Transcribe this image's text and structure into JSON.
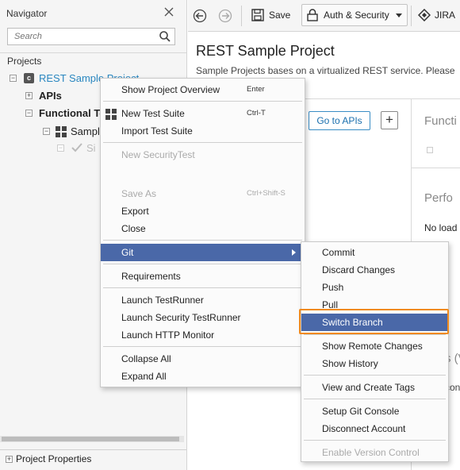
{
  "navigator": {
    "title": "Navigator",
    "search_placeholder": "Search",
    "projects_label": "Projects",
    "tree": {
      "project": "REST Sample Project",
      "apis": "APIs",
      "functional": "Functional Te",
      "suite": "Sampl",
      "case": "Si"
    },
    "project_properties": "Project Properties"
  },
  "toolbar": {
    "save": "Save",
    "auth": "Auth & Security",
    "jira": "JIRA"
  },
  "main": {
    "title": "REST Sample Project",
    "description": "Sample Projects bases on a virtualized REST service. Please",
    "goto_apis": "Go to APIs",
    "add": "+",
    "functional_title": "Functi",
    "performance_title": "Perfo",
    "no_load": "No load",
    "s_section": "s (V",
    "con_text": "con"
  },
  "context_menu": {
    "items": [
      {
        "label": "Show Project Overview",
        "shortcut": "Enter"
      },
      {
        "label": "New Test Suite",
        "shortcut": "Ctrl-T"
      },
      {
        "label": "Import Test Suite",
        "shortcut": ""
      },
      {
        "label": "New SecurityTest",
        "shortcut": ""
      },
      {
        "label": "Save As",
        "shortcut": "Ctrl+Shift-S"
      },
      {
        "label": "Export",
        "shortcut": ""
      },
      {
        "label": "Close",
        "shortcut": ""
      },
      {
        "label": "Git",
        "shortcut": ""
      },
      {
        "label": "Requirements",
        "shortcut": ""
      },
      {
        "label": "Launch TestRunner",
        "shortcut": ""
      },
      {
        "label": "Launch Security TestRunner",
        "shortcut": ""
      },
      {
        "label": "Launch HTTP Monitor",
        "shortcut": ""
      },
      {
        "label": "Collapse All",
        "shortcut": ""
      },
      {
        "label": "Expand All",
        "shortcut": ""
      }
    ]
  },
  "git_submenu": {
    "items": [
      "Commit",
      "Discard Changes",
      "Push",
      "Pull",
      "Switch Branch",
      "Show Remote Changes",
      "Show History",
      "View and Create Tags",
      "Setup Git Console",
      "Disconnect Account",
      "Enable Version Control"
    ]
  },
  "colors": {
    "accent": "#4a68a8",
    "highlight_border": "#f08a1c",
    "project_link": "#2a87c0"
  }
}
